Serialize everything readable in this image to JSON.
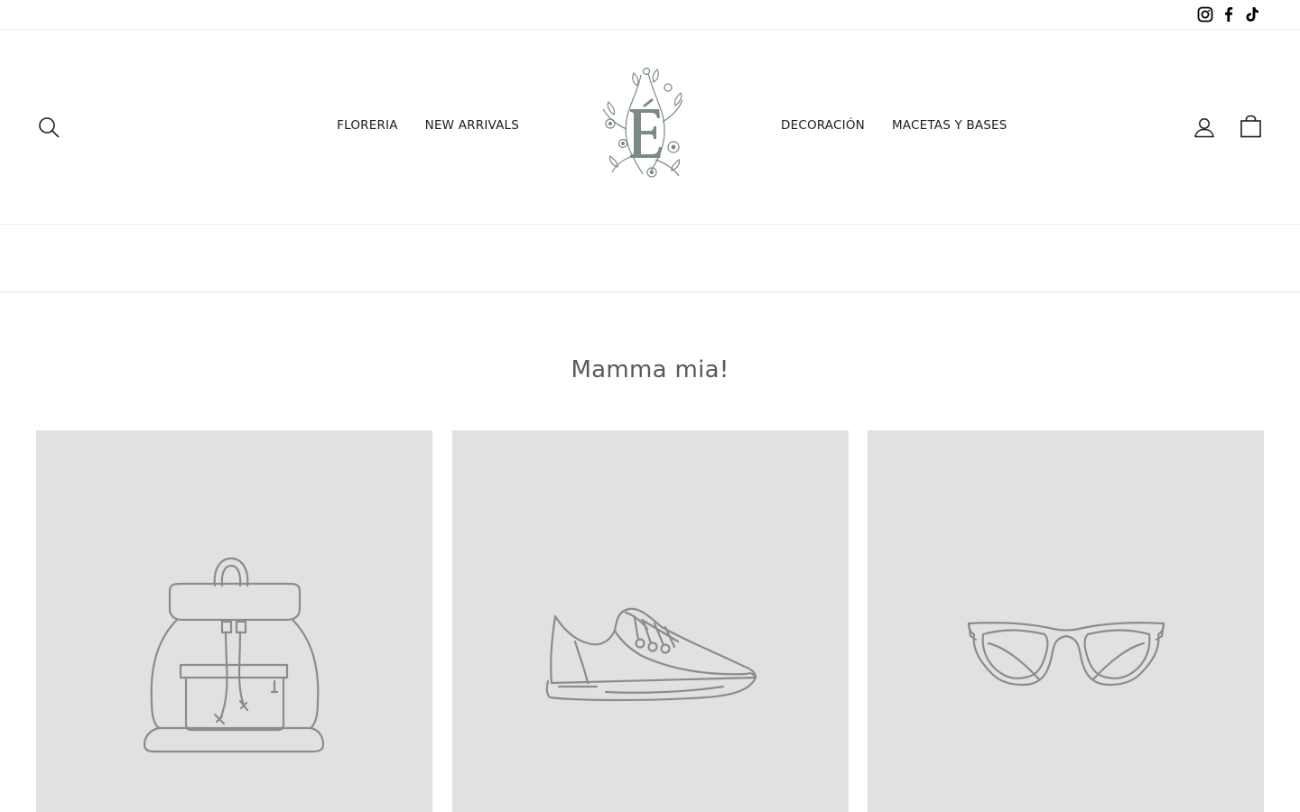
{
  "social": {
    "items": [
      {
        "name": "Instagram",
        "icon": "instagram-icon"
      },
      {
        "name": "Facebook",
        "icon": "facebook-icon"
      },
      {
        "name": "TikTok",
        "icon": "tiktok-icon"
      }
    ]
  },
  "header": {
    "nav_left": [
      {
        "label": "FLORERIA"
      },
      {
        "label": "NEW ARRIVALS"
      }
    ],
    "nav_right": [
      {
        "label": "DECORACIÓN"
      },
      {
        "label": "MACETAS Y BASES"
      }
    ],
    "logo_icon": "floral-e-monogram-logo",
    "icons": {
      "search": "search-icon",
      "account": "user-icon",
      "cart": "shopping-bag-icon"
    }
  },
  "main": {
    "title": "Mamma mia!",
    "products": [
      {
        "icon": "backpack-icon"
      },
      {
        "icon": "sneaker-icon"
      },
      {
        "icon": "sunglasses-icon"
      }
    ]
  },
  "colors": {
    "logo": "#7b8a85",
    "placeholder_bg": "#e1e1e1",
    "placeholder_line": "#8c8c8c",
    "title": "#555a5a"
  }
}
